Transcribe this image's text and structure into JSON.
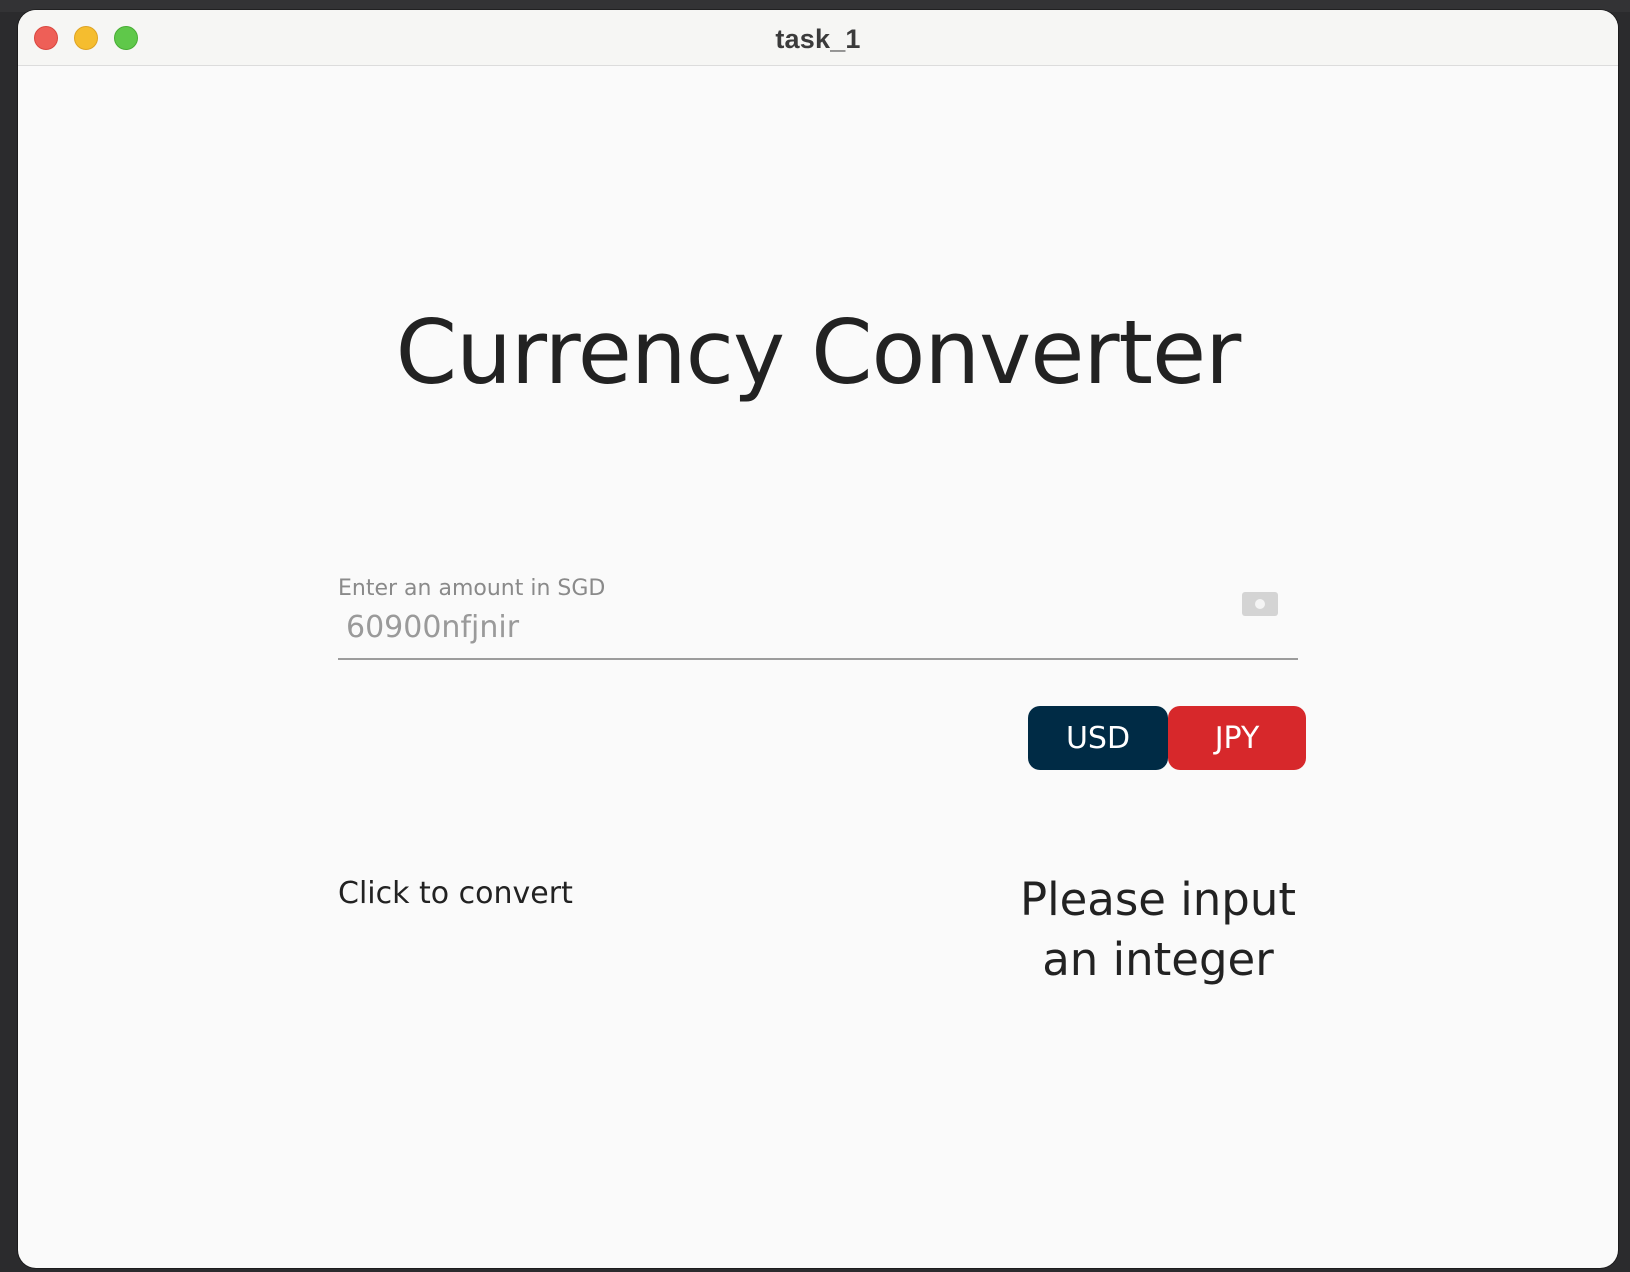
{
  "window": {
    "title": "task_1"
  },
  "main": {
    "heading": "Currency Converter",
    "amount_field": {
      "label": "Enter an amount in SGD",
      "value": "60900nfjnir",
      "icon": "money-icon"
    },
    "currency_buttons": [
      {
        "label": "USD",
        "color": "#002b45"
      },
      {
        "label": "JPY",
        "color": "#d7282b"
      }
    ],
    "convert_label": "Click to convert",
    "result_line1": "Please input",
    "result_line2": "an integer"
  }
}
